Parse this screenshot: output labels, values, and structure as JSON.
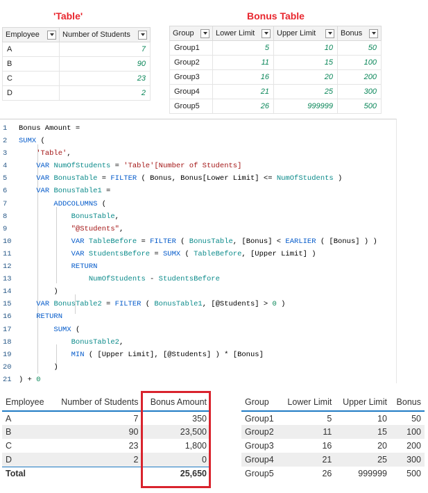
{
  "left_title": "'Table'",
  "right_title": "Bonus Table",
  "table": {
    "headers": [
      "Employee",
      "Number of Students"
    ],
    "rows": [
      [
        "A",
        "7"
      ],
      [
        "B",
        "90"
      ],
      [
        "C",
        "23"
      ],
      [
        "D",
        "2"
      ]
    ]
  },
  "bonus_table": {
    "headers": [
      "Group",
      "Lower Limit",
      "Upper Limit",
      "Bonus"
    ],
    "rows": [
      [
        "Group1",
        "5",
        "10",
        "50"
      ],
      [
        "Group2",
        "11",
        "15",
        "100"
      ],
      [
        "Group3",
        "16",
        "20",
        "200"
      ],
      [
        "Group4",
        "21",
        "25",
        "300"
      ],
      [
        "Group5",
        "26",
        "999999",
        "500"
      ]
    ]
  },
  "code_lines": [
    {
      "n": "1",
      "t": "Bonus Amount ="
    },
    {
      "n": "2",
      "t": "SUMX ("
    },
    {
      "n": "3",
      "t": "    'Table',"
    },
    {
      "n": "4",
      "t": "    VAR NumOfStudents = 'Table'[Number of Students]"
    },
    {
      "n": "5",
      "t": "    VAR BonusTable = FILTER ( Bonus, Bonus[Lower Limit] <= NumOfStudents )"
    },
    {
      "n": "6",
      "t": "    VAR BonusTable1 ="
    },
    {
      "n": "7",
      "t": "        ADDCOLUMNS ("
    },
    {
      "n": "8",
      "t": "            BonusTable,"
    },
    {
      "n": "9",
      "t": "            \"@Students\","
    },
    {
      "n": "10",
      "t": "            VAR TableBefore = FILTER ( BonusTable, [Bonus] < EARLIER ( [Bonus] ) )"
    },
    {
      "n": "11",
      "t": "            VAR StudentsBefore = SUMX ( TableBefore, [Upper Limit] )"
    },
    {
      "n": "12",
      "t": "            RETURN"
    },
    {
      "n": "13",
      "t": "                NumOfStudents - StudentsBefore"
    },
    {
      "n": "14",
      "t": "        )"
    },
    {
      "n": "15",
      "t": "    VAR BonusTable2 = FILTER ( BonusTable1, [@Students] > 0 )"
    },
    {
      "n": "16",
      "t": "    RETURN"
    },
    {
      "n": "17",
      "t": "        SUMX ("
    },
    {
      "n": "18",
      "t": "            BonusTable2,"
    },
    {
      "n": "19",
      "t": "            MIN ( [Upper Limit], [@Students] ) * [Bonus]"
    },
    {
      "n": "20",
      "t": "        )"
    },
    {
      "n": "21",
      "t": ") + 0"
    }
  ],
  "visual_left": {
    "headers": [
      "Employee",
      "Number of Students",
      "Bonus Amount"
    ],
    "rows": [
      [
        "A",
        "7",
        "350"
      ],
      [
        "B",
        "90",
        "23,500"
      ],
      [
        "C",
        "23",
        "1,800"
      ],
      [
        "D",
        "2",
        "0"
      ]
    ],
    "total": [
      "Total",
      "",
      "25,650"
    ]
  },
  "visual_right": {
    "headers": [
      "Group",
      "Lower Limit",
      "Upper Limit",
      "Bonus"
    ],
    "rows": [
      [
        "Group1",
        "5",
        "10",
        "50"
      ],
      [
        "Group2",
        "11",
        "15",
        "100"
      ],
      [
        "Group3",
        "16",
        "20",
        "200"
      ],
      [
        "Group4",
        "21",
        "25",
        "300"
      ],
      [
        "Group5",
        "26",
        "999999",
        "500"
      ]
    ]
  },
  "colors": {
    "title_red": "#e8262e",
    "highlight_box": "#d9232d",
    "accent_blue": "#1f7bc4"
  }
}
